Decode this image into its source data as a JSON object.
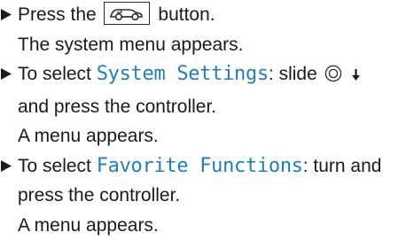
{
  "steps": [
    {
      "lines": {
        "pre": "Press the",
        "icon": "car-home-button-icon",
        "post": "button."
      },
      "result": "The system menu appears."
    },
    {
      "lines": {
        "pre": "To select ",
        "highlight": "System Settings",
        "mid": ": slide",
        "icon": "controller-icon",
        "arrow": "down-arrow-icon",
        "line2": "and press the controller."
      },
      "result": "A menu appears."
    },
    {
      "lines": {
        "pre": "To select ",
        "highlight": "Favorite Functions",
        "mid": ": turn and",
        "line2": "press the controller."
      },
      "result": "A menu appears."
    }
  ],
  "colors": {
    "highlight": "#1e7fb8",
    "text": "#1a1a1a"
  }
}
